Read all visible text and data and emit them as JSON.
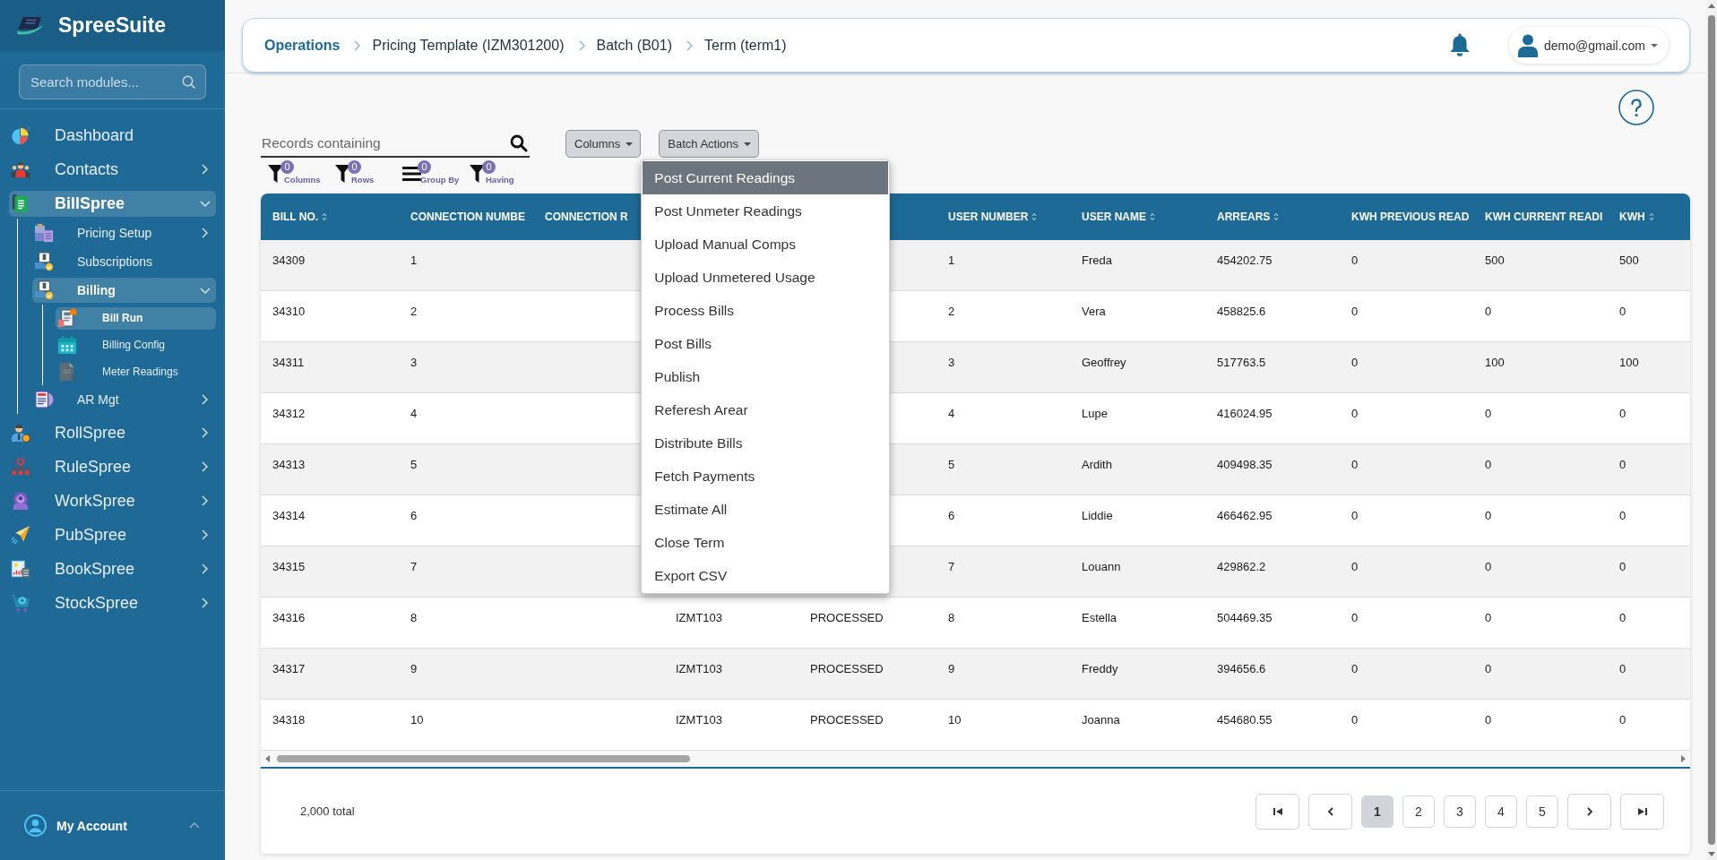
{
  "sidebar": {
    "brand": "SpreeSuite",
    "search": {
      "placeholder": "Search modules..."
    },
    "items": [
      {
        "label": "Dashboard",
        "selected": false
      },
      {
        "label": "Contacts",
        "selected": false,
        "expanded": false
      },
      {
        "label": "BillSpree",
        "selected": true,
        "expanded": true,
        "children": [
          {
            "label": "Pricing Setup",
            "selected": false,
            "expanded": false
          },
          {
            "label": "Subscriptions",
            "selected": false
          },
          {
            "label": "Billing",
            "selected": true,
            "expanded": true,
            "children": [
              {
                "label": "Bill Run",
                "selected": true
              },
              {
                "label": "Billing Config",
                "selected": false
              },
              {
                "label": "Meter Readings",
                "selected": false
              }
            ]
          },
          {
            "label": "AR Mgt",
            "selected": false,
            "expanded": false
          }
        ]
      },
      {
        "label": "RollSpree",
        "selected": false,
        "expanded": false
      },
      {
        "label": "RuleSpree",
        "selected": false,
        "expanded": false
      },
      {
        "label": "WorkSpree",
        "selected": false,
        "expanded": false
      },
      {
        "label": "PubSpree",
        "selected": false,
        "expanded": false
      },
      {
        "label": "BookSpree",
        "selected": false,
        "expanded": false
      },
      {
        "label": "StockSpree",
        "selected": false,
        "expanded": false
      }
    ],
    "account": {
      "label": "My Account"
    }
  },
  "header": {
    "breadcrumb": [
      "Operations",
      "Pricing Template (IZM301200)",
      "Batch (B01)",
      "Term (term1)"
    ],
    "user": "demo@gmail.com"
  },
  "toolbar": {
    "search": {
      "placeholder": "Records containing"
    },
    "buttons": [
      {
        "label": "Columns"
      },
      {
        "label": "Batch Actions",
        "menu": {
          "items": [
            {
              "label": "Post Current Readings",
              "selected": true
            },
            {
              "label": "Post Unmeter Readings",
              "selected": false
            },
            {
              "label": "Upload Manual Comps",
              "selected": false
            },
            {
              "label": "Upload Unmetered Usage",
              "selected": false
            },
            {
              "label": "Process Bills",
              "selected": false
            },
            {
              "label": "Post Bills",
              "selected": false
            },
            {
              "label": "Publish",
              "selected": false
            },
            {
              "label": "Referesh Arear",
              "selected": false
            },
            {
              "label": "Distribute Bills",
              "selected": false
            },
            {
              "label": "Fetch Payments",
              "selected": false
            },
            {
              "label": "Estimate All",
              "selected": false
            },
            {
              "label": "Close Term",
              "selected": false
            },
            {
              "label": "Export CSV",
              "selected": false
            }
          ]
        }
      }
    ],
    "filters": [
      {
        "kind": "filter",
        "label": "Columns",
        "count": "0"
      },
      {
        "kind": "filter",
        "label": "Rows",
        "count": "0"
      },
      {
        "kind": "group",
        "label": "Group By",
        "count": "0"
      },
      {
        "kind": "filter",
        "label": "Having",
        "count": "0"
      }
    ]
  },
  "table": {
    "columns": {
      "bill_no": {
        "label": "BILL NO.",
        "sortable": true
      },
      "column_2": {
        "label": "CONNECTION NUMBE"
      },
      "column_3": {
        "label": "CONNECTION R"
      },
      "user_number": {
        "label": "USER NUMBER",
        "sortable": true
      },
      "user_name": {
        "label": "USER NAME",
        "sortable": true
      },
      "arrears": {
        "label": "ARREARS",
        "sortable": true
      },
      "column_9": {
        "label": "KWH PREVIOUS READ"
      },
      "column_10": {
        "label": "KWH CURRENT READI"
      },
      "kwh": {
        "label": "KWH",
        "sortable": true
      }
    },
    "rows": [
      {
        "bill_no": "34309",
        "column_2": "1",
        "user_number": "1",
        "user_name": "Freda",
        "arrears": "454202.75",
        "column_9": "0",
        "column_10": "500",
        "kwh": "500"
      },
      {
        "bill_no": "34310",
        "column_2": "2",
        "user_number": "2",
        "user_name": "Vera",
        "arrears": "458825.6",
        "column_9": "0",
        "column_10": "0",
        "kwh": "0"
      },
      {
        "bill_no": "34311",
        "column_2": "3",
        "user_number": "3",
        "user_name": "Geoffrey",
        "arrears": "517763.5",
        "column_9": "0",
        "column_10": "100",
        "kwh": "100"
      },
      {
        "bill_no": "34312",
        "column_2": "4",
        "user_number": "4",
        "user_name": "Lupe",
        "arrears": "416024.95",
        "column_9": "0",
        "column_10": "0",
        "kwh": "0"
      },
      {
        "bill_no": "34313",
        "column_2": "5",
        "user_number": "5",
        "user_name": "Ardith",
        "arrears": "409498.35",
        "column_9": "0",
        "column_10": "0",
        "kwh": "0"
      },
      {
        "bill_no": "34314",
        "column_2": "6",
        "user_number": "6",
        "user_name": "Liddie",
        "arrears": "466462.95",
        "column_9": "0",
        "column_10": "0",
        "kwh": "0"
      },
      {
        "bill_no": "34315",
        "column_2": "7",
        "user_number": "7",
        "user_name": "Louann",
        "arrears": "429862.2",
        "column_9": "0",
        "column_10": "0",
        "kwh": "0"
      },
      {
        "bill_no": "34316",
        "column_2": "8",
        "column_4": "IZMT103",
        "column_5": "PROCESSED",
        "user_number": "8",
        "user_name": "Estella",
        "arrears": "504469.35",
        "column_9": "0",
        "column_10": "0",
        "kwh": "0"
      },
      {
        "bill_no": "34317",
        "column_2": "9",
        "column_4": "IZMT103",
        "column_5": "PROCESSED",
        "user_number": "9",
        "user_name": "Freddy",
        "arrears": "394656.6",
        "column_9": "0",
        "column_10": "0",
        "kwh": "0"
      },
      {
        "bill_no": "34318",
        "column_2": "10",
        "column_4": "IZMT103",
        "column_5": "PROCESSED",
        "user_number": "10",
        "user_name": "Joanna",
        "arrears": "454680.55",
        "column_9": "0",
        "column_10": "0",
        "kwh": "0"
      }
    ]
  },
  "footer": {
    "total": "2,000 total",
    "pages": [
      {
        "label": "1",
        "selected": true
      },
      {
        "label": "2",
        "selected": false
      },
      {
        "label": "3",
        "selected": false
      },
      {
        "label": "4",
        "selected": false
      },
      {
        "label": "5",
        "selected": false
      }
    ]
  }
}
